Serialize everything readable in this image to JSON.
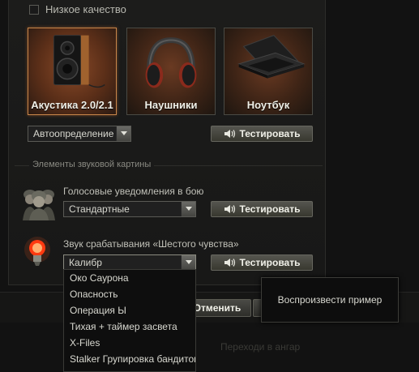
{
  "settings": {
    "low_quality_label": "Низкое качество",
    "low_quality_checked": false
  },
  "devices": [
    {
      "label": "Акустика 2.0/2.1",
      "icon": "speaker-icon",
      "active": true
    },
    {
      "label": "Наушники",
      "icon": "headphones-icon",
      "active": false
    },
    {
      "label": "Ноутбук",
      "icon": "laptop-icon",
      "active": false
    }
  ],
  "device_select": {
    "value": "Автоопределение"
  },
  "test_label": "Тестировать",
  "sound_elements": {
    "title": "Элементы звуковой картины",
    "voice": {
      "label": "Голосовые уведомления в бою",
      "value": "Стандартные",
      "icon": "soldiers-icon"
    },
    "sixth_sense": {
      "label": "Звук срабатывания «Шестого чувства»",
      "value": "Калибр",
      "icon": "lightbulb-icon"
    }
  },
  "dropdown_options": [
    "Око Саурона",
    "Опасность",
    "Операция Ы",
    "Тихая + таймер засвета",
    "X-Files",
    "Stalker Групировка бандитов"
  ],
  "tooltip": {
    "text": "Воспроизвести пример"
  },
  "footer": {
    "cancel_label": "Отменить",
    "faded_label": "Переходи в ангар"
  }
}
